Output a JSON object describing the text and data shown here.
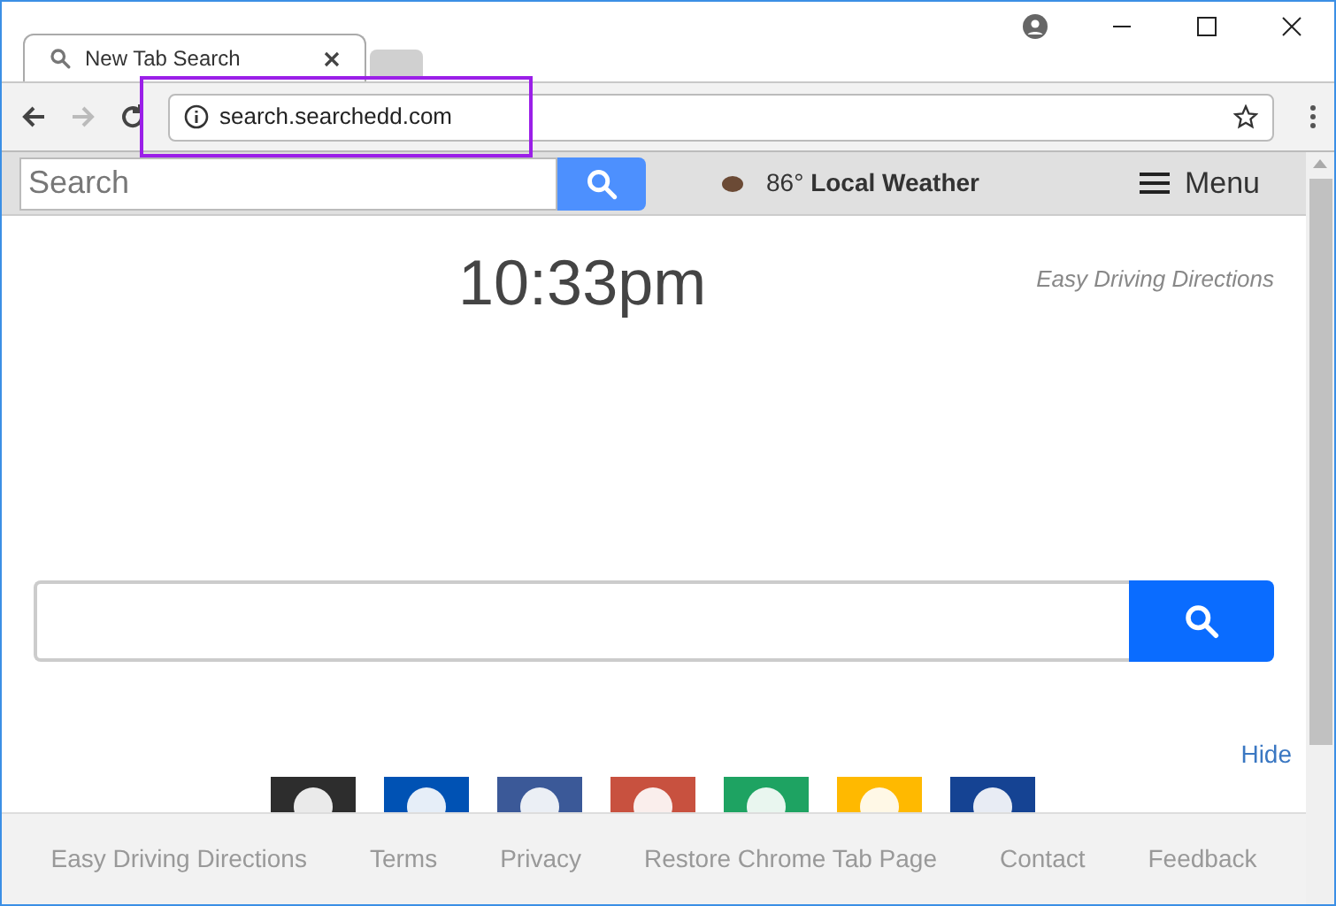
{
  "tab": {
    "title": "New Tab Search",
    "selected": true
  },
  "address_bar": {
    "value": "search.searchedd.com"
  },
  "top_bar": {
    "search_placeholder": "Search",
    "weather": {
      "temperature": "86°",
      "label": "Local Weather"
    },
    "menu": "Menu"
  },
  "clock": "10:33pm",
  "side_link": "Easy Driving Directions",
  "hide_link": "Hide",
  "shortcuts": [
    {
      "color": "#2d2d2d"
    },
    {
      "color": "#0052b4"
    },
    {
      "color": "#3b5998"
    },
    {
      "color": "#c8513f"
    },
    {
      "color": "#1ea362"
    },
    {
      "color": "#ffb900"
    },
    {
      "color": "#154393"
    }
  ],
  "footer_links": [
    "Easy Driving Directions",
    "Terms",
    "Privacy",
    "Restore Chrome Tab Page",
    "Contact",
    "Feedback"
  ]
}
